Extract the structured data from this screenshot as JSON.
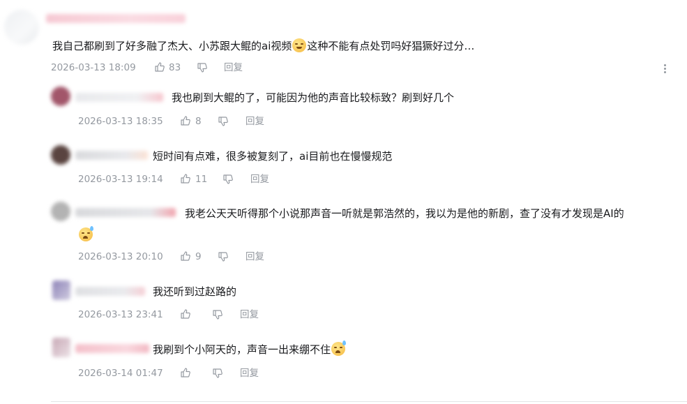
{
  "main_comment": {
    "text_before": "我自己都刷到了好多融了杰大、小苏跟大鲲的ai视频",
    "emoji": "doge-emoji",
    "text_after": "这种不能有点处罚吗好猖獗好过分…",
    "timestamp": "2026-03-13 18:09",
    "likes": "83",
    "reply_label": "回复"
  },
  "replies": [
    {
      "text": "我也刷到大鲲的了，可能因为他的声音比较标致？刷到好几个",
      "timestamp": "2026-03-13 18:35",
      "likes": "8",
      "reply_label": "回复"
    },
    {
      "text": "短时间有点难，很多被复刻了，ai目前也在慢慢规范",
      "timestamp": "2026-03-13 19:14",
      "likes": "11",
      "reply_label": "回复"
    },
    {
      "text": "我老公天天听得那个小说那声音一听就是郭浩然的，我以为是他的新剧，查了没有才发现是AI的",
      "emoji": "sweat-smile-emoji",
      "timestamp": "2026-03-13 20:10",
      "likes": "9",
      "reply_label": "回复"
    },
    {
      "text": "我还听到过赵路的",
      "timestamp": "2026-03-13 23:41",
      "likes": "",
      "reply_label": "回复"
    },
    {
      "text": "我刷到个小阿天的，声音一出来绷不住",
      "emoji": "sweat-smile-emoji",
      "timestamp": "2026-03-14 01:47",
      "likes": "",
      "reply_label": "回复"
    }
  ],
  "colors": {
    "text": "#18191c",
    "meta": "#9499a0",
    "divider": "#e3e5e7"
  }
}
